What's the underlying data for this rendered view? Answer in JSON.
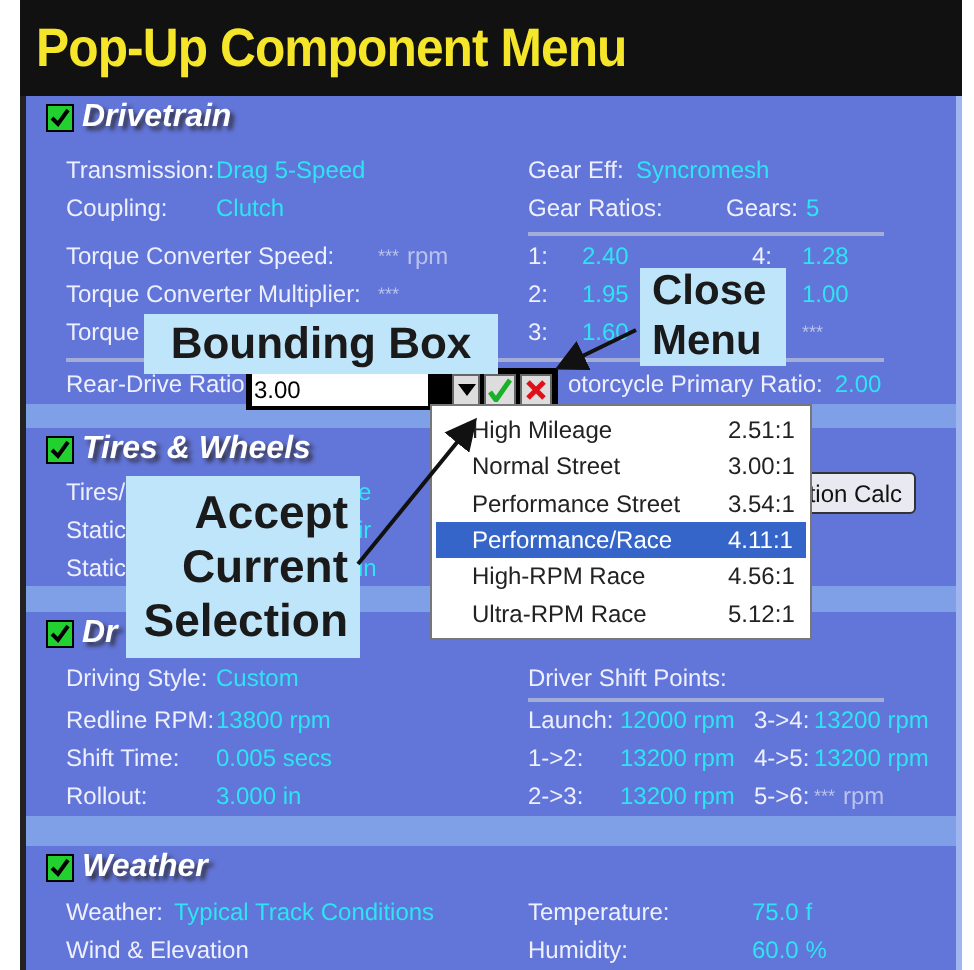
{
  "title": "Pop-Up Component Menu",
  "sections": [
    {
      "kind": "drivetrain",
      "title": "Drivetrain",
      "checked": true,
      "transmission": {
        "label": "Transmission:",
        "value": "Drag 5-Speed"
      },
      "coupling": {
        "label": "Coupling:",
        "value": "Clutch"
      },
      "gear_eff": {
        "label": "Gear Eff:",
        "value": "Syncromesh"
      },
      "gear_ratios_label": "Gear Ratios:",
      "gears": {
        "label": "Gears:",
        "value": "5"
      },
      "converter_speed": {
        "label": "Torque Converter Speed:",
        "value": "***",
        "unit": "rpm",
        "unset": true
      },
      "converter_multiplier": {
        "label": "Torque Converter Multiplier:",
        "value": "***",
        "unset": true
      },
      "torque_label": "Torque",
      "ratios": [
        {
          "index": "1:",
          "value": "2.40",
          "index2": "4:",
          "value2": "1.28",
          "unset2": false
        },
        {
          "index": "2:",
          "value": "1.95",
          "value2": "1.00",
          "unset2": false
        },
        {
          "index": "3:",
          "value": "1.60",
          "value2": "***",
          "unset2": true
        }
      ],
      "rear_drive": {
        "label": "Rear-Drive Ratio",
        "input": "3.00"
      },
      "primary": {
        "label": "otorcycle Primary Ratio:",
        "value": "2.00"
      }
    },
    {
      "kind": "tires",
      "title": "Tires & Wheels",
      "checked": true,
      "rows": [
        {
          "label": "Tires/",
          "value": "e"
        },
        {
          "label": "Static",
          "value": "ir"
        },
        {
          "label": "Static",
          "value": "in"
        }
      ],
      "button": "tion Calc"
    },
    {
      "kind": "driver",
      "title": "Dr",
      "checked": true,
      "left": [
        {
          "label": "Driving Style:",
          "value": "Custom"
        },
        {
          "label": "Redline RPM:",
          "value": "13800 rpm"
        },
        {
          "label": "Shift Time:",
          "value": "0.005 secs"
        },
        {
          "label": "Rollout:",
          "value": "3.000 in"
        }
      ],
      "shift_label": "Driver Shift Points:",
      "shifts": [
        {
          "label": "Launch:",
          "value": "12000 rpm",
          "label2": "3->4:",
          "value2": "13200 rpm",
          "unset2": false
        },
        {
          "label": "1->2:",
          "value": "13200 rpm",
          "label2": "4->5:",
          "value2": "13200 rpm",
          "unset2": false
        },
        {
          "label": "2->3:",
          "value": "13200 rpm",
          "label2": "5->6:",
          "value2": "***",
          "unit2": "rpm",
          "unset2": true
        }
      ]
    },
    {
      "kind": "weather",
      "title": "Weather",
      "checked": true,
      "left": [
        {
          "label": "Weather:",
          "value": "Typical Track Conditions"
        },
        {
          "label": "Wind & Elevation"
        }
      ],
      "right": [
        {
          "label": "Temperature:",
          "value": "75.0 f"
        },
        {
          "label": "Humidity:",
          "value": "60.0 %"
        }
      ]
    }
  ],
  "dropdown": {
    "items": [
      {
        "name": "High Mileage",
        "ratio": "2.51:1",
        "selected": false
      },
      {
        "name": "Normal Street",
        "ratio": "3.00:1",
        "selected": false
      },
      {
        "name": "Performance Street",
        "ratio": "3.54:1",
        "selected": false
      },
      {
        "name": "Performance/Race",
        "ratio": "4.11:1",
        "selected": true
      },
      {
        "name": "High-RPM Race",
        "ratio": "4.56:1",
        "selected": false
      },
      {
        "name": "Ultra-RPM Race",
        "ratio": "5.12:1",
        "selected": false
      }
    ]
  },
  "callouts": [
    {
      "kind": "bounding",
      "lines": [
        "Bounding Box"
      ]
    },
    {
      "kind": "close",
      "lines": [
        "Close",
        "Menu"
      ]
    },
    {
      "kind": "accept",
      "lines": [
        "Accept",
        "Current",
        "Selection"
      ]
    }
  ]
}
